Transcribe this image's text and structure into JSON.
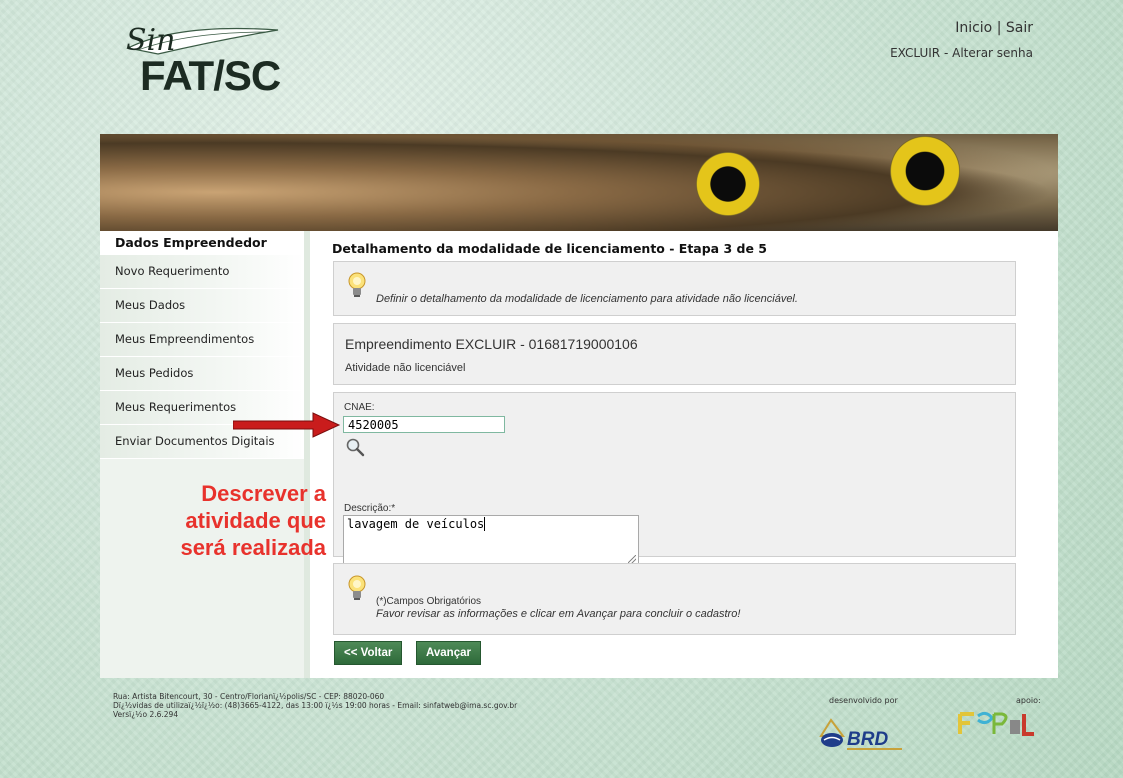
{
  "header": {
    "logo_text": "FAT/SC",
    "logo_script": "Sin",
    "link_inicio": "Inicio",
    "link_separator": "|",
    "link_sair": "Sair",
    "user_name": "EXCLUIR",
    "user_separator": "-",
    "link_alterar_senha": "Alterar senha"
  },
  "sidebar": {
    "title": "Dados Empreendedor",
    "items": [
      {
        "label": "Novo Requerimento"
      },
      {
        "label": "Meus Dados"
      },
      {
        "label": "Meus Empreendimentos"
      },
      {
        "label": "Meus Pedidos"
      },
      {
        "label": "Meus Requerimentos"
      },
      {
        "label": "Enviar Documentos Digitais"
      }
    ]
  },
  "content": {
    "page_title": "Detalhamento da modalidade de licenciamento - Etapa 3 de 5",
    "tip1": "Definir o detalhamento da modalidade de licenciamento para atividade não licenciável.",
    "empreendimento_title": "Empreendimento EXCLUIR - 01681719000106",
    "empreendimento_sub": "Atividade não licenciável",
    "cnae_label": "CNAE:",
    "cnae_value": "4520005",
    "descricao_label": "Descrição:*",
    "descricao_value": "lavagem de veículos",
    "tip2_line1": "(*)Campos Obrigatórios",
    "tip2_line2": "Favor revisar as informações e clicar em Avançar para concluir o cadastro!",
    "btn_voltar": "<< Voltar",
    "btn_avancar": "Avançar"
  },
  "annotation": {
    "lines": [
      "Descrever a",
      "atividade que",
      "será realizada"
    ],
    "color": "#e8322c"
  },
  "footer": {
    "line1": "Rua: Artista Bitencourt, 30 - Centro/Florianï¿½polis/SC - CEP: 88020-060",
    "line2": "Dï¿½vidas de utilizaï¿½ï¿½o: (48)3665-4122, das 13:00 ï¿½s 19:00 horas - Email: sinfatweb@ima.sc.gov.br",
    "line3": "Versï¿½o 2.6.294",
    "dev_label": "desenvolvido por",
    "dev_logo": "BRD",
    "apoio_label": "apoio:"
  },
  "colors": {
    "button_green": "#2e6a3a",
    "annotation_red": "#e8322c",
    "input_border": "#7fb8a0"
  }
}
